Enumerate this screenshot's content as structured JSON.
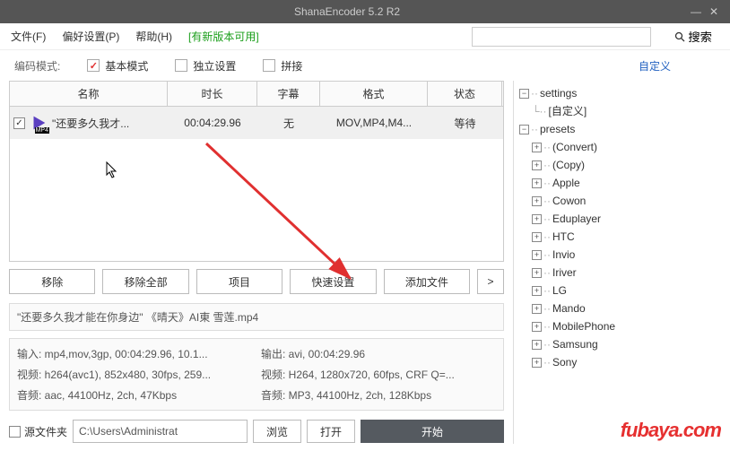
{
  "window": {
    "title": "ShanaEncoder 5.2 R2"
  },
  "menu": {
    "file": "文件(F)",
    "pref": "偏好设置(P)",
    "help": "帮助(H)",
    "update": "[有新版本可用]"
  },
  "search": {
    "placeholder": "",
    "btn": "搜索"
  },
  "mode": {
    "label": "编码模式:",
    "basic": "基本模式",
    "indep": "独立设置",
    "concat": "拼接",
    "custom": "自定义"
  },
  "grid": {
    "headers": {
      "name": "名称",
      "dur": "时长",
      "sub": "字幕",
      "fmt": "格式",
      "stat": "状态"
    },
    "rows": [
      {
        "name": "\"还要多久我才...",
        "dur": "00:04:29.96",
        "sub": "无",
        "fmt": "MOV,MP4,M4...",
        "stat": "等待"
      }
    ]
  },
  "buttons": {
    "remove": "移除",
    "removeAll": "移除全部",
    "project": "项目",
    "quick": "快速设置",
    "add": "添加文件",
    "more": ">"
  },
  "fileLabel": "\"还要多久我才能在你身边\" 《晴天》AI東 雪莲.mp4",
  "info": {
    "in1": "输入:  mp4,mov,3gp, 00:04:29.96, 10.1...",
    "in2": "视频:  h264(avc1), 852x480, 30fps, 259...",
    "in3": "音频:  aac, 44100Hz, 2ch, 47Kbps",
    "out1": "输出:  avi, 00:04:29.96",
    "out2": "视频:  H264, 1280x720, 60fps, CRF Q=...",
    "out3": "音频:  MP3, 44100Hz, 2ch, 128Kbps"
  },
  "path": {
    "srcLabel": "源文件夹",
    "value": "C:\\Users\\Administrat",
    "browse": "浏览",
    "open": "打开",
    "start": "开始"
  },
  "tree": {
    "settings": "settings",
    "customSetting": "[自定义]",
    "presets": "presets",
    "items": [
      "(Convert)",
      "(Copy)",
      "Apple",
      "Cowon",
      "Eduplayer",
      "HTC",
      "Invio",
      "Iriver",
      "LG",
      "Mando",
      "MobilePhone",
      "Samsung",
      "Sony"
    ]
  },
  "watermark": "fubaya.com"
}
